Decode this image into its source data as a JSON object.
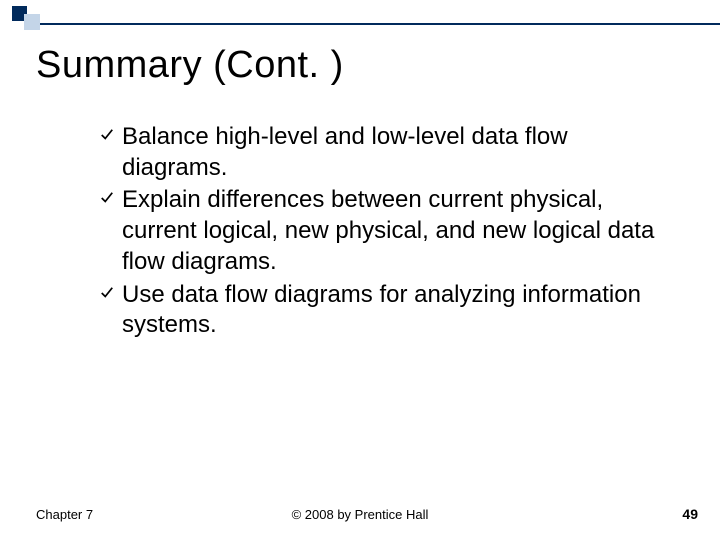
{
  "slide": {
    "title": "Summary (Cont. )",
    "bullets": [
      "Balance high-level and low-level data flow diagrams.",
      "Explain differences between current physical, current logical, new physical, and new logical data flow diagrams.",
      "Use data flow diagrams for analyzing information systems."
    ]
  },
  "footer": {
    "chapter": "Chapter 7",
    "copyright": "© 2008 by Prentice Hall",
    "page": "49"
  },
  "icons": {
    "check": "check-icon"
  },
  "colors": {
    "accent": "#012a5c",
    "accent_light": "#c4d5e8"
  }
}
